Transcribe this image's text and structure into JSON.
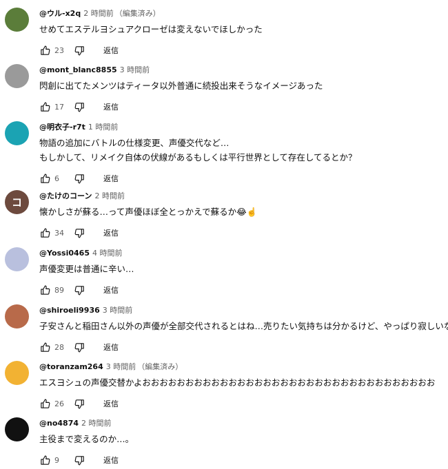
{
  "comments": [
    {
      "author": "@ウル-x2q",
      "time": "2 時間前",
      "edited": "（編集済み）",
      "lines": [
        "せめてエステルヨシュアクローゼは変えないでほしかった"
      ],
      "likes": "23",
      "reply": "返信",
      "avatar_color": "#5b7d3a"
    },
    {
      "author": "@mont_blanc8855",
      "time": "3 時間前",
      "edited": "",
      "lines": [
        "閃創に出てたメンツはティータ以外普通に続投出来そうなイメージあった"
      ],
      "likes": "17",
      "reply": "返信",
      "avatar_color": "#9a9a9a"
    },
    {
      "author": "@明衣子-r7t",
      "time": "1 時間前",
      "edited": "",
      "lines": [
        "物語の追加にバトルの仕様変更、声優交代など…",
        "もしかして、リメイク自体の伏線があるもしくは平行世界として存在してるとか？"
      ],
      "likes": "6",
      "reply": "返信",
      "avatar_color": "#1ba3b3"
    },
    {
      "author": "@たけのコーン",
      "time": "2 時間前",
      "edited": "",
      "lines": [
        "懐かしさが蘇る…って声優ほぼ全とっかえで蘇るか😂☝️"
      ],
      "likes": "34",
      "reply": "返信",
      "avatar_letter": "コ",
      "avatar_color": "#6d4a3e"
    },
    {
      "author": "@Yossi0465",
      "time": "4 時間前",
      "edited": "",
      "lines": [
        "声優変更は普通に辛い…"
      ],
      "likes": "89",
      "reply": "返信",
      "avatar_color": "#b9c0de"
    },
    {
      "author": "@shiroeli9936",
      "time": "3 時間前",
      "edited": "",
      "lines": [
        "子安さんと稲田さん以外の声優が全部交代されるとはね…売りたい気持ちは分かるけど、やっぱり寂しいな"
      ],
      "likes": "28",
      "reply": "返信",
      "avatar_color": "#b86a4a"
    },
    {
      "author": "@toranzam264",
      "time": "3 時間前",
      "edited": "（編集済み）",
      "lines": [
        "エスヨシュの声優交替かよおおおおおおおおおおおおおおおおおおおおおおおおおおおおおおおおおお"
      ],
      "likes": "26",
      "reply": "返信",
      "avatar_color": "#f2b233"
    },
    {
      "author": "@no4874",
      "time": "2 時間前",
      "edited": "",
      "lines": [
        "主役まで変えるのか…。"
      ],
      "likes": "9",
      "reply": "返信",
      "avatar_color": "#111111"
    }
  ]
}
